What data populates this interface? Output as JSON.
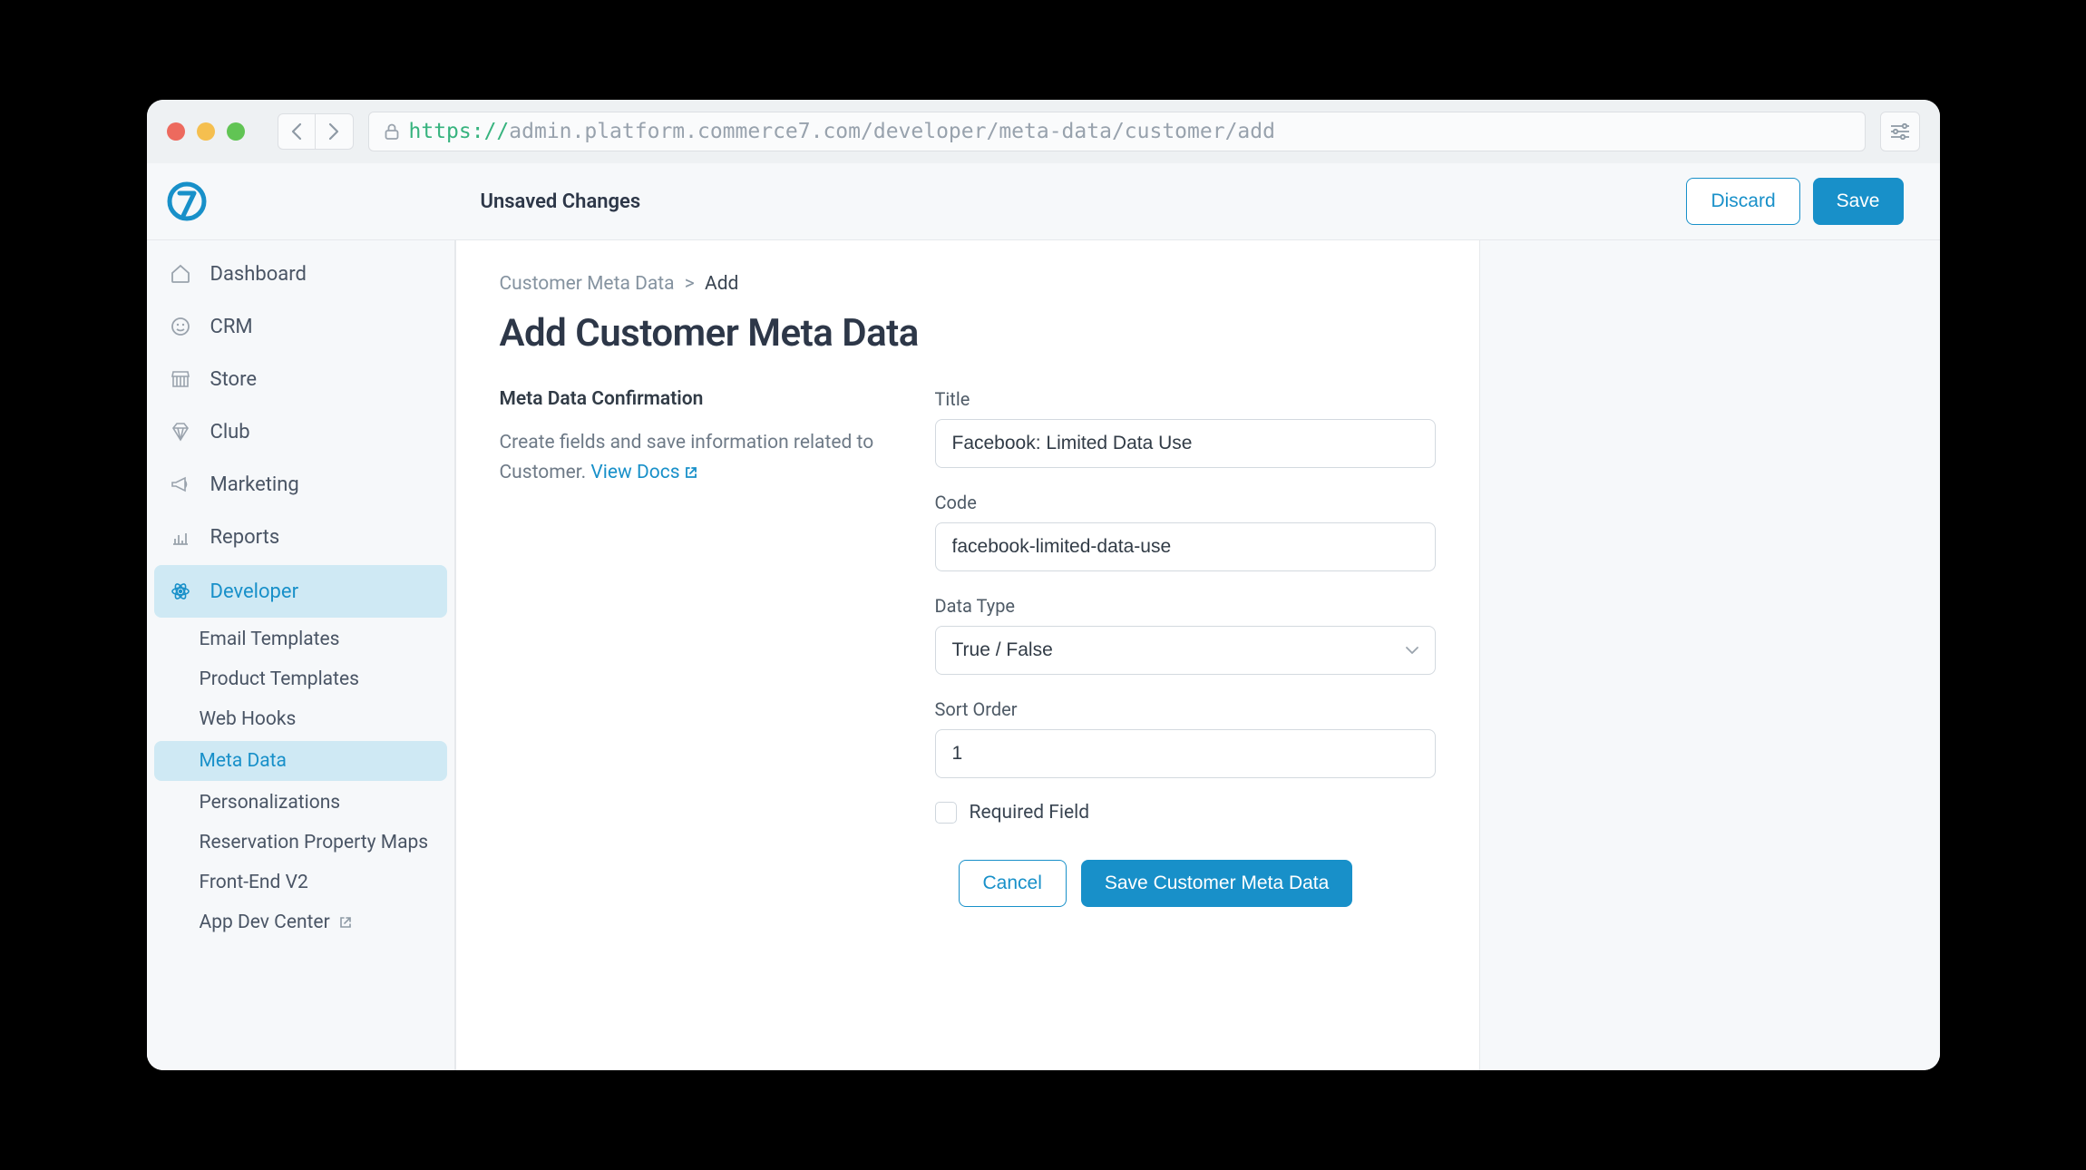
{
  "url": {
    "scheme": "https://",
    "rest": "admin.platform.commerce7.com/developer/meta-data/customer/add"
  },
  "topbar": {
    "title": "Unsaved Changes",
    "discard": "Discard",
    "save": "Save"
  },
  "sidebar": {
    "items": [
      {
        "label": "Dashboard"
      },
      {
        "label": "CRM"
      },
      {
        "label": "Store"
      },
      {
        "label": "Club"
      },
      {
        "label": "Marketing"
      },
      {
        "label": "Reports"
      },
      {
        "label": "Developer"
      }
    ],
    "sub": [
      {
        "label": "Email Templates"
      },
      {
        "label": "Product Templates"
      },
      {
        "label": "Web Hooks"
      },
      {
        "label": "Meta Data"
      },
      {
        "label": "Personalizations"
      },
      {
        "label": "Reservation Property Maps"
      },
      {
        "label": "Front-End V2"
      },
      {
        "label": "App Dev Center"
      }
    ]
  },
  "breadcrumb": {
    "parent": "Customer Meta Data",
    "sep": ">",
    "current": "Add"
  },
  "page": {
    "title": "Add Customer Meta Data"
  },
  "section": {
    "title": "Meta Data Confirmation",
    "desc": "Create fields and save information related to Customer. ",
    "doclink": "View Docs"
  },
  "form": {
    "title_label": "Title",
    "title_value": "Facebook: Limited Data Use",
    "code_label": "Code",
    "code_value": "facebook-limited-data-use",
    "datatype_label": "Data Type",
    "datatype_value": "True / False",
    "sort_label": "Sort Order",
    "sort_value": "1",
    "required_label": "Required Field",
    "cancel": "Cancel",
    "submit": "Save Customer Meta Data"
  }
}
